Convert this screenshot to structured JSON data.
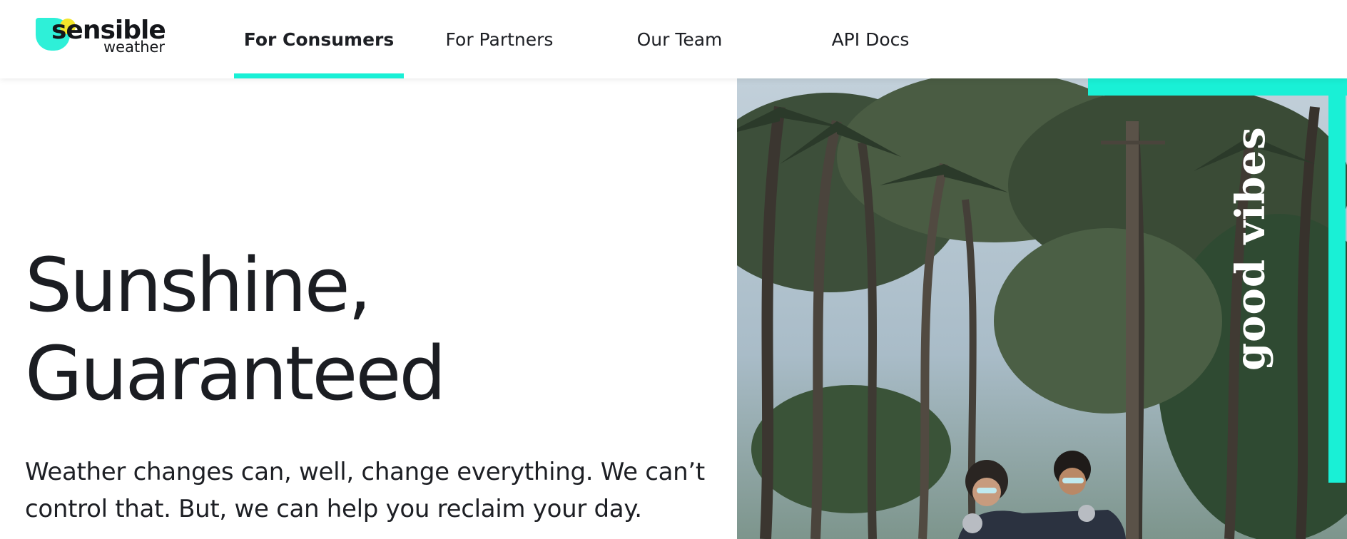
{
  "brand": {
    "name": "sensible",
    "tagline": "weather",
    "colors": {
      "accent": "#19f0d6",
      "sun": "#f2e52b",
      "text": "#1d1f24"
    }
  },
  "nav": {
    "items": [
      {
        "label": "For Consumers",
        "active": true
      },
      {
        "label": "For Partners",
        "active": false
      },
      {
        "label": "Our Team",
        "active": false
      },
      {
        "label": "API Docs",
        "active": false
      }
    ]
  },
  "hero": {
    "title_line1": "Sunshine,",
    "title_line2": "Guaranteed",
    "subtitle": "Weather changes can, well, change everything. We can’t control that. But, we can help you reclaim your day."
  },
  "photo": {
    "overlay_text": "good vibes"
  }
}
